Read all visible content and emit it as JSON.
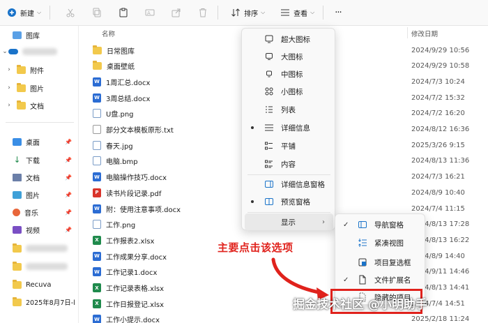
{
  "toolbar": {
    "new_label": "新建",
    "sort_label": "排序",
    "view_label": "查看",
    "more_label": "···"
  },
  "sidebar": {
    "items": [
      {
        "label": "图库"
      },
      {
        "label": "附件"
      },
      {
        "label": "图片"
      },
      {
        "label": "文档"
      },
      {
        "label": "桌面"
      },
      {
        "label": "下载"
      },
      {
        "label": "文档"
      },
      {
        "label": "图片"
      },
      {
        "label": "音乐"
      },
      {
        "label": "视频"
      },
      {
        "label": "Recuva"
      },
      {
        "label": "2025年8月7日-l"
      }
    ]
  },
  "file_list": {
    "headers": {
      "name": "名称",
      "modified": "修改日期"
    },
    "rows": [
      {
        "name": "日常图库",
        "date": "2024/9/29 10:56",
        "type": "folder"
      },
      {
        "name": "桌面壁纸",
        "date": "2024/9/29 10:58",
        "type": "folder"
      },
      {
        "name": "1周汇总.docx",
        "date": "2024/7/3 10:24",
        "type": "docx"
      },
      {
        "name": "3周总结.docx",
        "date": "2024/7/2 15:32",
        "type": "docx"
      },
      {
        "name": "U盘.png",
        "date": "2024/7/2 16:20",
        "type": "img"
      },
      {
        "name": "部分文本模板原形.txt",
        "date": "2024/8/12 16:36",
        "type": "txt"
      },
      {
        "name": "春天.jpg",
        "date": "2025/3/26 9:15",
        "type": "img"
      },
      {
        "name": "电脑.bmp",
        "date": "2024/8/13 11:36",
        "type": "img"
      },
      {
        "name": "电脑操作技巧.docx",
        "date": "2024/7/3 16:21",
        "type": "docx"
      },
      {
        "name": "读书片段记录.pdf",
        "date": "2024/8/9 10:40",
        "type": "pdf"
      },
      {
        "name": "附：使用注意事项.docx",
        "date": "2024/7/4 11:15",
        "type": "docx"
      },
      {
        "name": "工作.png",
        "date": "2024/8/13 17:28",
        "type": "img"
      },
      {
        "name": "工作报表2.xlsx",
        "date": "2024/8/13 16:22",
        "type": "xlsx"
      },
      {
        "name": "工作成果分享.docx",
        "date": "2024/8/9 14:40",
        "type": "docx"
      },
      {
        "name": "工作记录1.docx",
        "date": "2024/9/11 14:46",
        "type": "docx"
      },
      {
        "name": "工作记录表格.xlsx",
        "date": "2024/8/13 14:41",
        "type": "xlsx"
      },
      {
        "name": "工作日报登记.xlsx",
        "date": "2024/7/4 14:51",
        "type": "xlsx"
      },
      {
        "name": "工作小提示.docx",
        "date": "2025/2/18 11:24",
        "type": "docx"
      }
    ]
  },
  "view_menu": {
    "items": [
      {
        "label": "超大图标",
        "icon": "monitor-icon",
        "selected": false
      },
      {
        "label": "大图标",
        "icon": "monitor-icon",
        "selected": false
      },
      {
        "label": "中图标",
        "icon": "monitor-icon",
        "selected": false
      },
      {
        "label": "小图标",
        "icon": "grid-icon",
        "selected": false
      },
      {
        "label": "列表",
        "icon": "list-icon",
        "selected": false
      },
      {
        "label": "详细信息",
        "icon": "details-icon",
        "selected": true
      },
      {
        "label": "平铺",
        "icon": "tiles-icon",
        "selected": false
      },
      {
        "label": "内容",
        "icon": "content-icon",
        "selected": false
      },
      {
        "label": "详细信息窗格",
        "icon": "pane-icon",
        "selected": false
      },
      {
        "label": "预览窗格",
        "icon": "pane-icon",
        "selected": true
      }
    ],
    "show_label": "显示",
    "show_arrow": "›"
  },
  "show_submenu": {
    "items": [
      {
        "label": "导航窗格",
        "checked": true
      },
      {
        "label": "紧凑视图",
        "checked": false
      },
      {
        "label": "项目复选框",
        "checked": false
      },
      {
        "label": "文件扩展名",
        "checked": true
      },
      {
        "label": "隐藏的项目",
        "checked": false
      }
    ]
  },
  "annotation": {
    "text": "主要点击该选项",
    "color": "#e0221c"
  },
  "watermark": "掘金技术社区 @小明助手"
}
